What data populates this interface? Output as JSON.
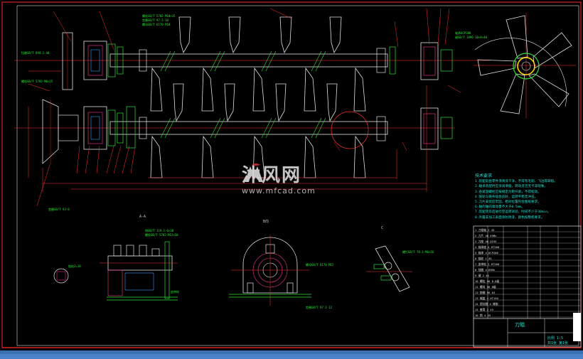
{
  "watermark": {
    "cn": "沐风网",
    "url": "www.mfcad.com"
  },
  "notes": {
    "title": "技术要求",
    "lines": [
      "1.装配前各零件须清洗干净，不得有毛刺、飞边等缺陷。",
      "2.轴承装配时应涂润滑脂，转动灵活无卡滞现象。",
      "3.各紧固螺栓应按规定力矩拧紧，不得松动。",
      "4.链轮与链条啮合良好，运转平稳无冲击。",
      "5.刀片安装应牢固，相对位置符合图纸要求。",
      "6.轴的轴向窜动量不大于0.5mm。",
      "7.装配完毕后进行空运转试验，时间不少于30min。",
      "8.外露非加工表面涂防锈漆，颜色按整机要求。"
    ]
  },
  "title_block": {
    "name": "刀辊",
    "sub1": "比例 1:5",
    "sub2": "共1张 第1张"
  },
  "views": {
    "a": "A-A",
    "b": "B向",
    "c": "C"
  },
  "callouts": [
    {
      "id": "c1",
      "text": "螺栓GB/T 5782-M10×35"
    },
    {
      "id": "c2",
      "text": "垫圈GB/T 97.1-10"
    },
    {
      "id": "c3",
      "text": "螺母GB/T 6170-M10"
    },
    {
      "id": "c4",
      "text": "轴承UCP208"
    },
    {
      "id": "c5",
      "text": "键GB/T 1096-10×8×40"
    },
    {
      "id": "c6",
      "text": "挡圈GB/T 894.1-40"
    },
    {
      "id": "c7",
      "text": "螺栓GB/T 5783-M8×25"
    },
    {
      "id": "c8",
      "text": "垫圈GB/T 93-8"
    },
    {
      "id": "c9",
      "text": "销GB/T 119.1-6×30"
    },
    {
      "id": "c10",
      "text": "螺栓GB/T 5782-M12×50"
    },
    {
      "id": "c11",
      "text": "螺母GB/T 6170-M12"
    },
    {
      "id": "c12",
      "text": "垫圈GB/T 97.1-12"
    },
    {
      "id": "c13",
      "text": "螺钉GB/T 70.1-M6×16"
    },
    {
      "id": "c14",
      "text": "链轮Z=18"
    },
    {
      "id": "c15",
      "text": "皮带轮"
    }
  ],
  "bom_rows": [
    "1 刀辊轴 1 45",
    "2 刀片 48 65Mn",
    "3 刀座 48 Q235",
    "4 轴承座 4 HT200",
    "5 轴承 4 UCP208",
    "6 链轮 1 45",
    "7 皮带轮 1 HT200",
    "8 挡圈 4 65Mn",
    "9 键 2 45",
    "10 螺栓 96 8.8级",
    "11 螺母 96 8级",
    "12 垫圈 96 A3",
    "13 端盖 4 HT150",
    "14 密封圈 4 橡胶",
    "15 套筒 2 45",
    "16 销 4 35"
  ]
}
